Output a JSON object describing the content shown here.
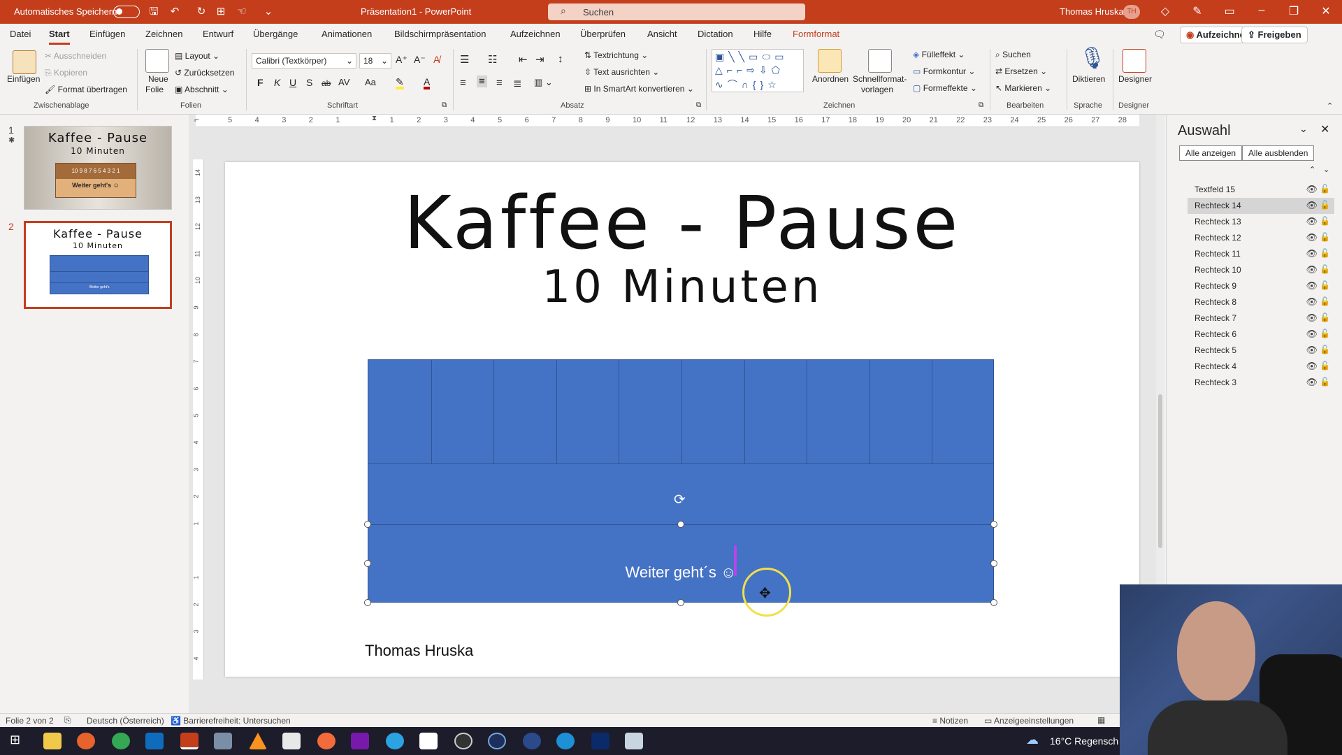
{
  "titlebar": {
    "autosave_label": "Automatisches Speichern",
    "doc_title": "Präsentation1 - PowerPoint",
    "search_placeholder": "Suchen",
    "user_name": "Thomas Hruska",
    "user_initials": "TH"
  },
  "menu": {
    "tabs": [
      "Datei",
      "Start",
      "Einfügen",
      "Zeichnen",
      "Entwurf",
      "Übergänge",
      "Animationen",
      "Bildschirmpräsentation",
      "Aufzeichnen",
      "Überprüfen",
      "Ansicht",
      "Dictation",
      "Hilfe",
      "Formformat"
    ],
    "record_button": "Aufzeichnen",
    "share_button": "Freigeben"
  },
  "ribbon": {
    "clipboard": {
      "paste": "Einfügen",
      "cut": "Ausschneiden",
      "copy": "Kopieren",
      "format_painter": "Format übertragen",
      "group": "Zwischenablage"
    },
    "slides": {
      "new_slide_1": "Neue",
      "new_slide_2": "Folie",
      "layout": "Layout",
      "reset": "Zurücksetzen",
      "section": "Abschnitt",
      "group": "Folien"
    },
    "font": {
      "font_name": "Calibri (Textkörper)",
      "font_size": "18",
      "group": "Schriftart",
      "bold": "F",
      "italic": "K",
      "underline": "U",
      "shadow": "S",
      "strike": "ab",
      "spacing": "AV",
      "case": "Aa",
      "color_letter": "A"
    },
    "paragraph": {
      "text_direction": "Textrichtung",
      "align_text": "Text ausrichten",
      "smartart": "In SmartArt konvertieren",
      "group": "Absatz"
    },
    "drawing": {
      "arrange_1": "Anordnen",
      "quick_styles_1": "Schnellformat-",
      "quick_styles_2": "vorlagen",
      "fill": "Fülleffekt",
      "outline": "Formkontur",
      "effects": "Formeffekte",
      "group": "Zeichnen"
    },
    "editing": {
      "find": "Suchen",
      "replace": "Ersetzen",
      "select": "Markieren",
      "group": "Bearbeiten"
    },
    "voice": {
      "dictate": "Diktieren",
      "group": "Sprache"
    },
    "designer": {
      "designer": "Designer",
      "group": "Designer"
    }
  },
  "ruler": {
    "h_ticks": [
      "5",
      "4",
      "3",
      "2",
      "1",
      "",
      "1",
      "2",
      "3",
      "4",
      "5",
      "6",
      "7",
      "8",
      "9",
      "10",
      "11",
      "12",
      "13",
      "14",
      "15",
      "16",
      "17",
      "18",
      "19",
      "20",
      "21",
      "22",
      "23",
      "24",
      "25",
      "26",
      "27",
      "28"
    ],
    "v_ticks": [
      "14",
      "13",
      "12",
      "11",
      "10",
      "9",
      "8",
      "7",
      "6",
      "5",
      "4",
      "3",
      "2",
      "1",
      "",
      "1",
      "2",
      "3",
      "4"
    ]
  },
  "thumbnails": [
    {
      "number": "1",
      "title": "Kaffee - Pause",
      "subtitle": "10 Minuten",
      "timer": "10 9 8 7 6 5 4 3 2 1",
      "caption": "Weiter geht's ☺"
    },
    {
      "number": "2",
      "title": "Kaffee - Pause",
      "subtitle": "10 Minuten",
      "caption": "Weiter geht's"
    }
  ],
  "slide": {
    "title": "Kaffee - Pause",
    "subtitle": "10 Minuten",
    "button_text": "Weiter geht´s ☺",
    "author": "Thomas Hruska",
    "block_color": "#4472c4"
  },
  "selection_pane": {
    "title": "Auswahl",
    "show_all": "Alle anzeigen",
    "hide_all": "Alle ausblenden",
    "items": [
      "Textfeld 15",
      "Rechteck 14",
      "Rechteck 13",
      "Rechteck 12",
      "Rechteck 11",
      "Rechteck 10",
      "Rechteck 9",
      "Rechteck 8",
      "Rechteck 7",
      "Rechteck 6",
      "Rechteck 5",
      "Rechteck 4",
      "Rechteck 3"
    ],
    "selected_item": "Rechteck 14"
  },
  "status": {
    "slide_of": "Folie 2 von 2",
    "language": "Deutsch (Österreich)",
    "accessibility": "Barrierefreiheit: Untersuchen",
    "notes": "Notizen",
    "display_settings": "Anzeigeeinstellungen"
  },
  "taskbar": {
    "weather": "16°C  Regensch"
  },
  "colors": {
    "accent": "#c43e1c",
    "shape_blue": "#4472c4"
  }
}
